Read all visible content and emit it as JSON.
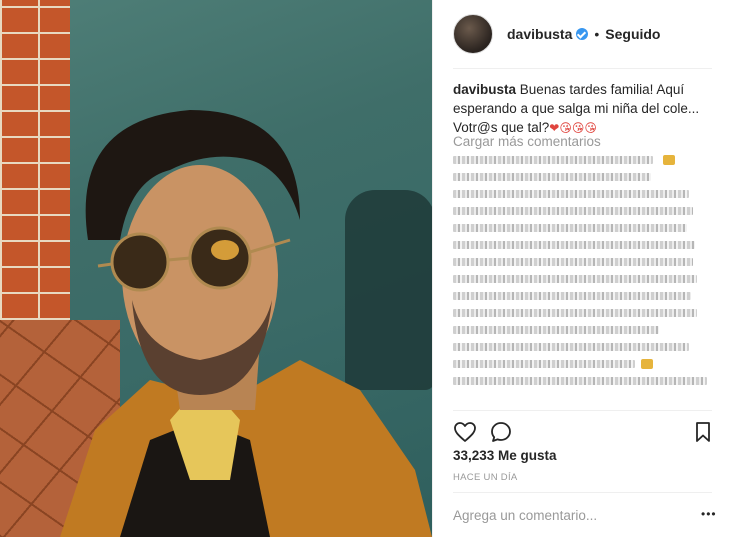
{
  "post": {
    "username": "davibusta",
    "dot": "•",
    "follow_status": "Seguido",
    "caption_user": "davibusta",
    "caption_text": "Buenas tardes familia! Aquí esperando a que salga mi niña del cole... Votr@s que tal?",
    "caption_emojis": "❤😘😘😘",
    "load_more": "Cargar más comentarios",
    "likes": "33,233 Me gusta",
    "time_ago": "HACE UN DÍA",
    "comment_placeholder": "Agrega un comentario...",
    "more_options": "•••"
  },
  "icons": {
    "verified": "verified-badge-icon",
    "like": "heart-icon",
    "comment": "comment-bubble-icon",
    "save": "bookmark-icon"
  },
  "colors": {
    "verified": "#3897f0",
    "muted_text": "#999999",
    "text": "#262626"
  }
}
